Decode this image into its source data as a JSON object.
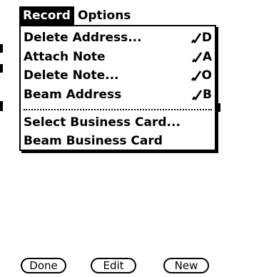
{
  "menubar": {
    "menus": [
      {
        "label": "Record",
        "active": true
      },
      {
        "label": "Options",
        "active": false
      }
    ]
  },
  "dropdown": {
    "items": [
      {
        "label": "Delete Address...",
        "shortcut": "D"
      },
      {
        "label": "Attach Note",
        "shortcut": "A"
      },
      {
        "label": "Delete Note...",
        "shortcut": "O"
      },
      {
        "label": "Beam Address",
        "shortcut": "B"
      },
      {
        "label": "Select Business Card...",
        "shortcut": ""
      },
      {
        "label": "Beam Business Card",
        "shortcut": ""
      }
    ],
    "shortcut_icon": "command-stroke-icon"
  },
  "buttons": {
    "done": "Done",
    "edit": "Edit",
    "new": "New"
  },
  "colors": {
    "foreground": "#000000",
    "background": "#ffffff"
  }
}
